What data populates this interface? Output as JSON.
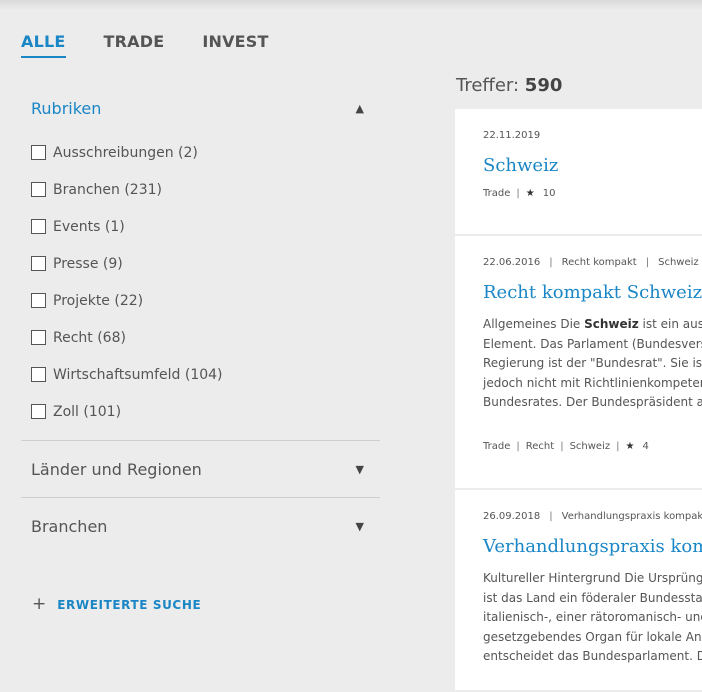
{
  "tabs": [
    {
      "label": "ALLE",
      "active": true
    },
    {
      "label": "TRADE",
      "active": false
    },
    {
      "label": "INVEST",
      "active": false
    }
  ],
  "sidebar": {
    "rubriken": {
      "title": "Rubriken",
      "items": [
        {
          "label": "Ausschreibungen (2)"
        },
        {
          "label": "Branchen (231)"
        },
        {
          "label": "Events (1)"
        },
        {
          "label": "Presse (9)"
        },
        {
          "label": "Projekte (22)"
        },
        {
          "label": "Recht (68)"
        },
        {
          "label": "Wirtschaftsumfeld (104)"
        },
        {
          "label": "Zoll (101)"
        }
      ]
    },
    "laender": {
      "title": "Länder und Regionen"
    },
    "branchen": {
      "title": "Branchen"
    },
    "advanced_search": "ERWEITERTE SUCHE"
  },
  "results": {
    "hits_label": "Treffer:",
    "hits_count": "590",
    "items": [
      {
        "date": "22.11.2019",
        "title": "Schweiz",
        "tag1": "Trade",
        "rating": "10"
      },
      {
        "date": "22.06.2016",
        "category": "Recht kompakt",
        "country": "Schweiz",
        "title": "Recht kompakt Schweiz",
        "excerpt_pre": "Allgemeines Die ",
        "excerpt_bold": "Schweiz",
        "excerpt_post": " ist ein aus Z",
        "excerpt_lines": [
          "Element. Das Parlament (Bundesversa",
          "Regierung ist der \"Bundesrat\". Sie ist l",
          "jedoch nicht mit Richtlinienkompeten",
          "Bundesrates. Der Bundespräsident als"
        ],
        "tag1": "Trade",
        "tag2": "Recht",
        "tag3": "Schweiz",
        "rating": "4"
      },
      {
        "date": "26.09.2018",
        "category": "Verhandlungspraxis kompakt",
        "title": "Verhandlungspraxis komp",
        "excerpt_lines": [
          "Kultureller Hintergrund Die Ursprünge",
          "ist das Land ein föderaler Bundesstaa",
          "italienisch-, einer rätoromanisch- und",
          "gesetzgebendes Organ für lokale Ang",
          "entscheidet das Bundesparlament. De"
        ]
      }
    ]
  },
  "colors": {
    "accent": "#1a86c6",
    "background": "#ececec"
  }
}
